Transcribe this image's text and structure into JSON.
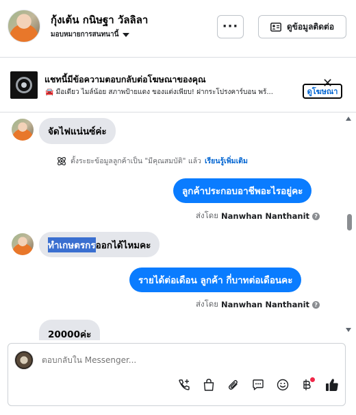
{
  "header": {
    "contact_name": "กุ้งเต้น กนิษฐา วัลลิลา",
    "assign_label": "มอบหมายการสนทนานี้",
    "more_label": "···",
    "contact_info_label": "ดูข้อมูลติดต่อ"
  },
  "ad": {
    "title": "แชทนี้มีข้อความตอบกลับต่อโฆษณาของคุณ",
    "text": "🚘 มือเดียว ไมล์น้อย สภาพป้ายแดง ของแต่งเพียบ! ฝากระโปรงคาร์บอน พร้...",
    "view_ad_label": "ดูโฆษณา",
    "close_label": "✕"
  },
  "messages": {
    "m1": "จัดไฟแน่นซ์ค่ะ",
    "system_text": "ตั้งระยะข้อมูลลูกค้าเป็น \"มีคุณสมบัติ\" แล้ว",
    "system_learn": "เรียนรู้เพิ่มเติม",
    "m2": "ลูกค้าประกอบอาชีพอะไรอยู่คะ",
    "sent_by_prefix": "ส่งโดย",
    "sent_by_name": "Nanwhan Nanthanit",
    "m3_highlight": "ทำเกษตรกร",
    "m3_rest": "ออกได้ไหมคะ",
    "m4": "รายได้ต่อเดือน  ลูกค้า  กี่บาทต่อเดือนคะ",
    "m5": "20000ค่ะ"
  },
  "composer": {
    "placeholder": "ตอบกลับใน Messenger..."
  },
  "icons": {
    "call": "phone-add-icon",
    "shop": "shopping-bag-icon",
    "attach": "paperclip-icon",
    "saved": "saved-reply-icon",
    "emoji": "emoji-icon",
    "pay": "baht-payment-icon",
    "like": "thumbs-up-icon"
  },
  "colors": {
    "accent": "#0a7cff",
    "incoming": "#e4e6eb",
    "link": "#0064d1"
  }
}
